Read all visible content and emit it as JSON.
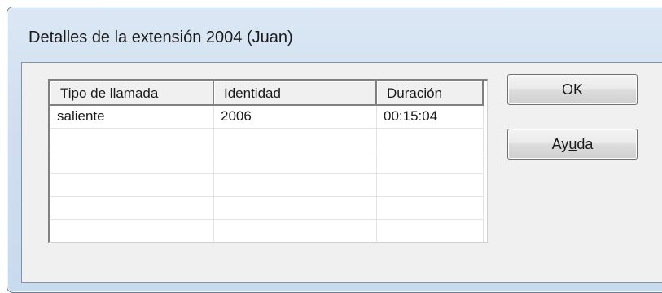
{
  "window": {
    "title": "Detalles de la extensión 2004  (Juan)"
  },
  "table": {
    "columns": [
      "Tipo de llamada",
      "Identidad",
      "Duración"
    ],
    "rows": [
      [
        "saliente",
        "2006",
        "00:15:04"
      ],
      [
        "",
        "",
        ""
      ],
      [
        "",
        "",
        ""
      ],
      [
        "",
        "",
        ""
      ],
      [
        "",
        "",
        ""
      ],
      [
        "",
        "",
        ""
      ]
    ]
  },
  "buttons": {
    "ok_label": "OK",
    "help_label_pre": "Ay",
    "help_label_accel": "u",
    "help_label_post": "da"
  }
}
